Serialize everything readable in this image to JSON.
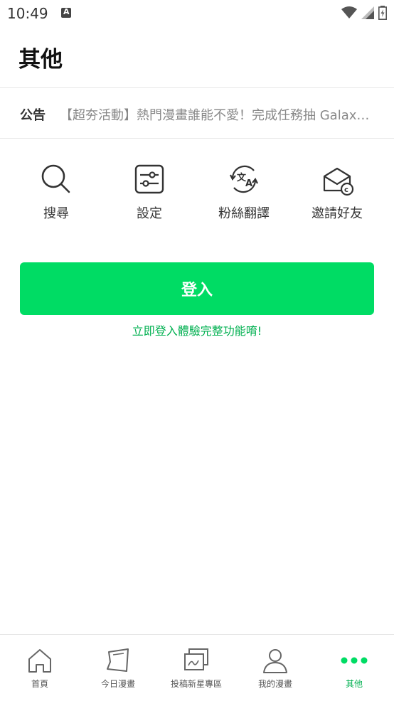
{
  "status_bar": {
    "time": "10:49"
  },
  "page": {
    "title": "其他"
  },
  "notice": {
    "label": "公告",
    "text": "【超夯活動】熱門漫畫誰能不愛！完成任務抽 Galaxy..."
  },
  "menu": {
    "items": [
      {
        "label": "搜尋",
        "icon": "search-icon"
      },
      {
        "label": "設定",
        "icon": "settings-sliders-icon"
      },
      {
        "label": "粉絲翻譯",
        "icon": "translate-icon"
      },
      {
        "label": "邀請好友",
        "icon": "invite-mail-icon"
      }
    ]
  },
  "login": {
    "button_label": "登入",
    "hint": "立即登入體驗完整功能唷!"
  },
  "bottom_nav": {
    "items": [
      {
        "label": "首頁",
        "icon": "home-icon"
      },
      {
        "label": "今日漫畫",
        "icon": "comic-icon"
      },
      {
        "label": "投稿新星專區",
        "icon": "gallery-icon"
      },
      {
        "label": "我的漫畫",
        "icon": "user-icon"
      },
      {
        "label": "其他",
        "icon": "more-dots-icon",
        "active": true
      }
    ]
  },
  "colors": {
    "accent": "#00dc64",
    "accent_text": "#00b050"
  }
}
